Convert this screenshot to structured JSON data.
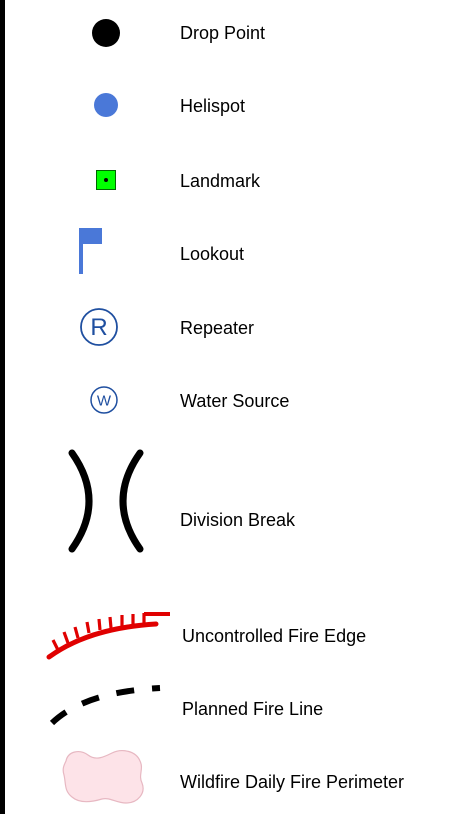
{
  "legend": {
    "items": [
      {
        "label": "Drop Point",
        "symbol": "black-filled-circle",
        "color": "#000000"
      },
      {
        "label": "Helispot",
        "symbol": "blue-filled-circle",
        "color": "#4a78d8"
      },
      {
        "label": "Landmark",
        "symbol": "green-square-with-dot",
        "color": "#00ff00"
      },
      {
        "label": "Lookout",
        "symbol": "blue-flag",
        "color": "#4a78d8"
      },
      {
        "label": "Repeater",
        "symbol": "circled-r",
        "color": "#1f4fa0",
        "glyph": "R"
      },
      {
        "label": "Water Source",
        "symbol": "circled-w",
        "color": "#1f4fa0",
        "glyph": "W"
      },
      {
        "label": "Division Break",
        "symbol": "opposing-arcs",
        "color": "#000000"
      },
      {
        "label": "Uncontrolled Fire Edge",
        "symbol": "red-hatched-arc",
        "color": "#e00000"
      },
      {
        "label": "Planned Fire Line",
        "symbol": "black-dashed-arc",
        "color": "#000000"
      },
      {
        "label": "Wildfire Daily Fire Perimeter",
        "symbol": "pink-blob",
        "color": "#fde3e8"
      }
    ]
  }
}
